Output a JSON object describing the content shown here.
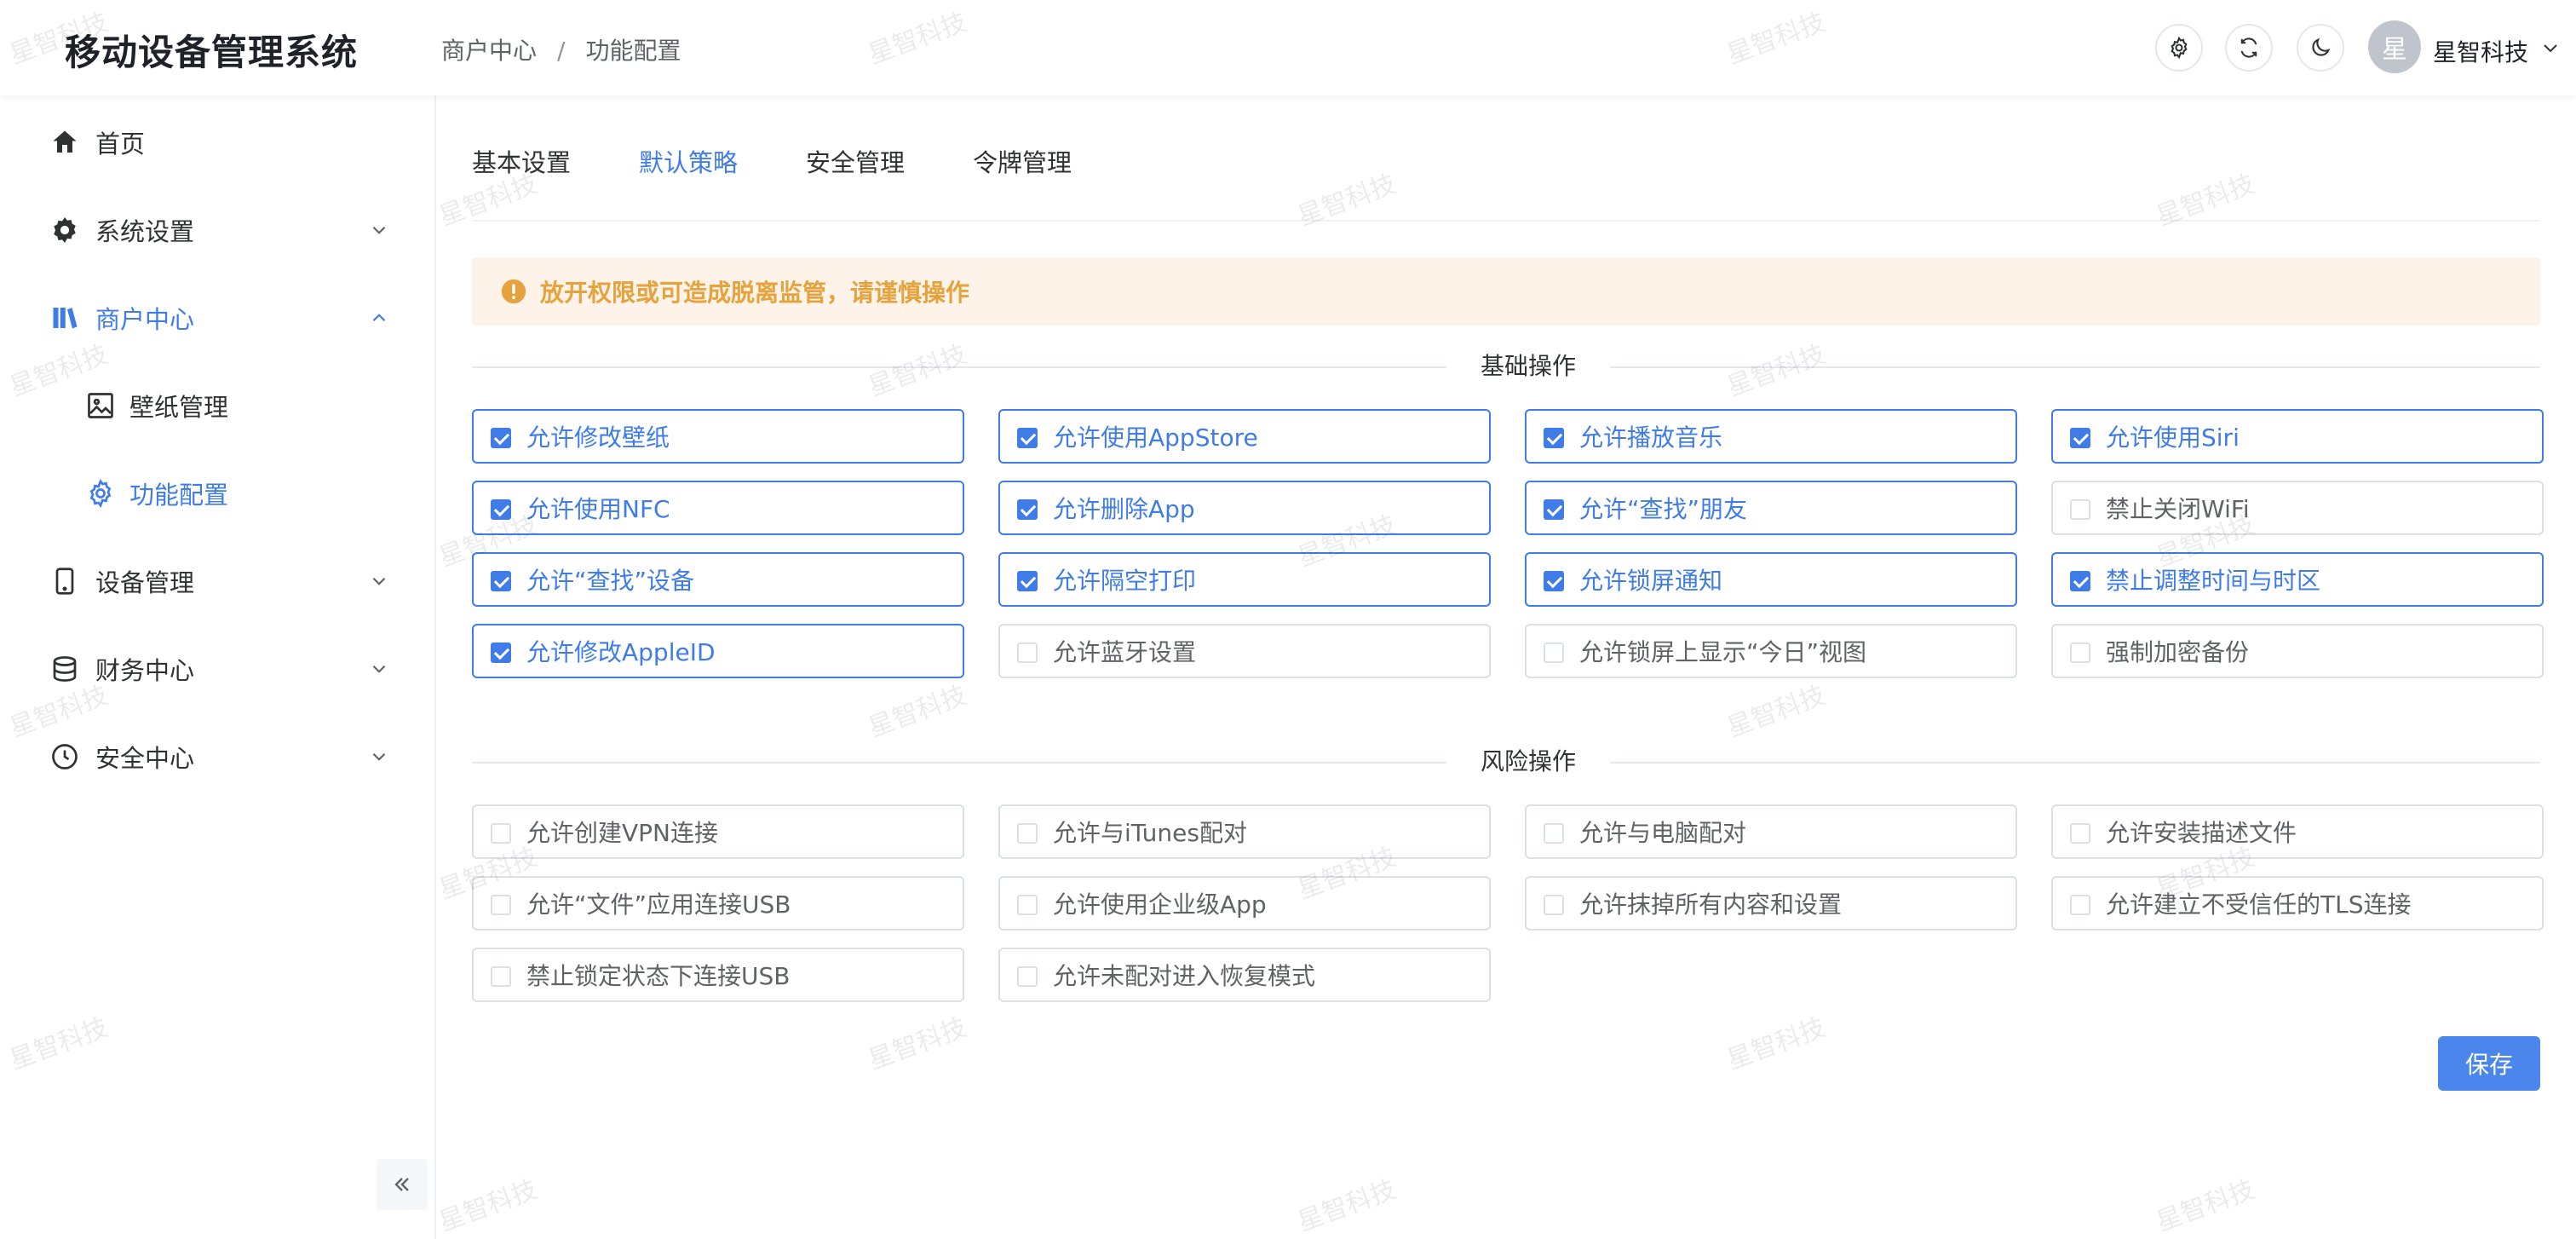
{
  "header": {
    "app_title": "移动设备管理系统",
    "breadcrumb": [
      "商户中心",
      "/",
      "功能配置"
    ],
    "buttons": [
      {
        "name": "settings-button",
        "icon": "gear-icon"
      },
      {
        "name": "refresh-button",
        "icon": "refresh-icon"
      },
      {
        "name": "theme-button",
        "icon": "moon-icon"
      }
    ],
    "avatar_text": "星",
    "user_name": "星智科技"
  },
  "sidebar": {
    "items": [
      {
        "label": "首页",
        "icon": "home-icon",
        "expandable": false
      },
      {
        "label": "系统设置",
        "icon": "gear-icon",
        "expandable": true,
        "expanded": false
      },
      {
        "label": "商户中心",
        "icon": "library-icon",
        "expandable": true,
        "expanded": true,
        "active": true
      },
      {
        "label": "壁纸管理",
        "icon": "image-icon",
        "sub": true
      },
      {
        "label": "功能配置",
        "icon": "gear-outline-icon",
        "sub": true,
        "active": true
      },
      {
        "label": "设备管理",
        "icon": "phone-icon",
        "expandable": true,
        "expanded": false
      },
      {
        "label": "财务中心",
        "icon": "coins-icon",
        "expandable": true,
        "expanded": false
      },
      {
        "label": "安全中心",
        "icon": "clock-icon",
        "expandable": true,
        "expanded": false
      }
    ]
  },
  "tabs": [
    {
      "label": "基本设置",
      "active": false
    },
    {
      "label": "默认策略",
      "active": true
    },
    {
      "label": "安全管理",
      "active": false
    },
    {
      "label": "令牌管理",
      "active": false
    }
  ],
  "alert": {
    "text": "放开权限或可造成脱离监管，请谨慎操作"
  },
  "sections": [
    {
      "title": "基础操作",
      "options": [
        {
          "label": "允许修改壁纸",
          "checked": true
        },
        {
          "label": "允许使用AppStore",
          "checked": true
        },
        {
          "label": "允许播放音乐",
          "checked": true
        },
        {
          "label": "允许使用Siri",
          "checked": true
        },
        {
          "label": "允许使用NFC",
          "checked": true
        },
        {
          "label": "允许删除App",
          "checked": true
        },
        {
          "label": "允许“查找”朋友",
          "checked": true
        },
        {
          "label": "禁止关闭WiFi",
          "checked": false
        },
        {
          "label": "允许“查找”设备",
          "checked": true
        },
        {
          "label": "允许隔空打印",
          "checked": true
        },
        {
          "label": "允许锁屏通知",
          "checked": true
        },
        {
          "label": "禁止调整时间与时区",
          "checked": true
        },
        {
          "label": "允许修改AppleID",
          "checked": true
        },
        {
          "label": "允许蓝牙设置",
          "checked": false
        },
        {
          "label": "允许锁屏上显示“今日”视图",
          "checked": false
        },
        {
          "label": "强制加密备份",
          "checked": false
        }
      ]
    },
    {
      "title": "风险操作",
      "options": [
        {
          "label": "允许创建VPN连接",
          "checked": false
        },
        {
          "label": "允许与iTunes配对",
          "checked": false
        },
        {
          "label": "允许与电脑配对",
          "checked": false
        },
        {
          "label": "允许安装描述文件",
          "checked": false
        },
        {
          "label": "允许“文件”应用连接USB",
          "checked": false
        },
        {
          "label": "允许使用企业级App",
          "checked": false
        },
        {
          "label": "允许抹掉所有内容和设置",
          "checked": false
        },
        {
          "label": "允许建立不受信任的TLS连接",
          "checked": false
        },
        {
          "label": "禁止锁定状态下连接USB",
          "checked": false
        },
        {
          "label": "允许未配对进入恢复模式",
          "checked": false
        }
      ]
    }
  ],
  "save_label": "保存",
  "watermark": "星智科技",
  "colors": {
    "primary": "#3f7ce8",
    "warning": "#e6a23c",
    "warning_bg": "#fdf3e8"
  }
}
